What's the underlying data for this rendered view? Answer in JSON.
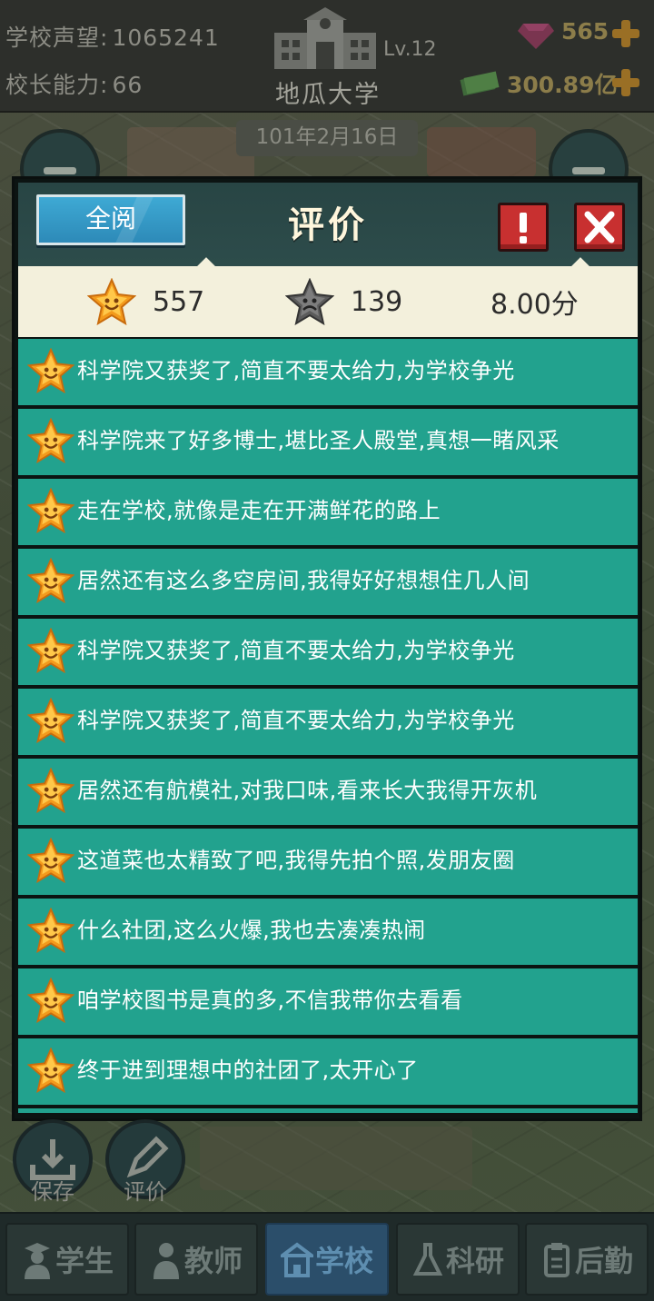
{
  "hud": {
    "reputation_label": "学校声望:",
    "reputation_value": "1065241",
    "ability_label": "校长能力:",
    "ability_value": "66",
    "school_level": "Lv.12",
    "school_name": "地瓜大学",
    "gems": "565",
    "money": "300.89亿",
    "date": "101年2月16日"
  },
  "dialog": {
    "read_all_label": "全阅",
    "title": "评价"
  },
  "summary": {
    "good_count": "557",
    "bad_count": "139",
    "score": "8.00分"
  },
  "reviews": [
    "科学院又获奖了,简直不要太给力,为学校争光",
    "科学院来了好多博士,堪比圣人殿堂,真想一睹风采",
    "走在学校,就像是走在开满鲜花的路上",
    "居然还有这么多空房间,我得好好想想住几人间",
    "科学院又获奖了,简直不要太给力,为学校争光",
    "科学院又获奖了,简直不要太给力,为学校争光",
    "居然还有航模社,对我口味,看来长大我得开灰机",
    "这道菜也太精致了吧,我得先拍个照,发朋友圈",
    "什么社团,这么火爆,我也去凑凑热闹",
    "咱学校图书是真的多,不信我带你去看看",
    "终于进到理想中的社团了,太开心了"
  ],
  "quick_actions": {
    "save_label": "保存",
    "review_label": "评价"
  },
  "tabs": [
    {
      "label": "学生",
      "icon": "student-icon"
    },
    {
      "label": "教师",
      "icon": "teacher-icon"
    },
    {
      "label": "学校",
      "icon": "school-icon",
      "active": true
    },
    {
      "label": "科研",
      "icon": "flask-icon"
    },
    {
      "label": "后勤",
      "icon": "clipboard-icon"
    }
  ],
  "colors": {
    "row_green": "#22a28e",
    "summary_bg": "#f3f0dc",
    "close_red": "#c83030",
    "read_all_blue": "#3ea9d4"
  }
}
